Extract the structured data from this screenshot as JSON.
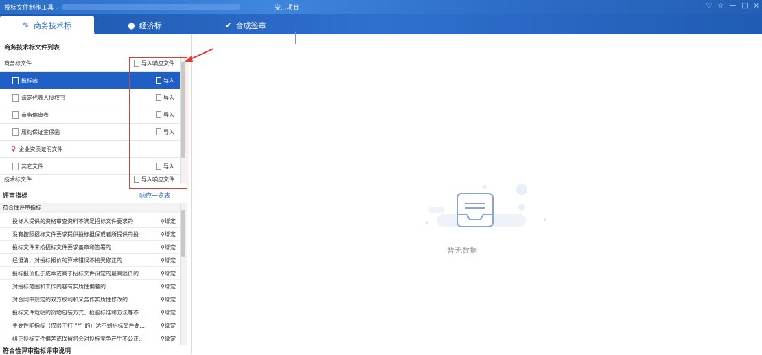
{
  "window": {
    "app_title": "投标文件制作工具 -",
    "project_suffix": "安...项目",
    "controls": [
      "♡",
      "☆",
      "—",
      "□",
      "×"
    ]
  },
  "tabs": [
    {
      "label": "商务技术标",
      "icon": "edit-icon"
    },
    {
      "label": "经济标",
      "icon": "yen-circle-icon"
    },
    {
      "label": "合成签章",
      "icon": "check-circle-icon"
    }
  ],
  "file_list": {
    "title": "商务技术标文件列表",
    "group_commercial": "商务标文件",
    "group_commercial_action": "导入响应文件",
    "items": [
      {
        "label": "投标函",
        "action": "导入",
        "selected": true
      },
      {
        "label": "法定代表人授权书",
        "action": "导入"
      },
      {
        "label": "商务偏离表",
        "action": "导入"
      },
      {
        "label": "履约保证金保函",
        "action": "导入"
      },
      {
        "label": "企业资质证明文件",
        "action": ""
      },
      {
        "label": "其它文件",
        "action": "导入"
      }
    ],
    "group_technical": "技术标文件",
    "group_technical_action": "导入响应文件"
  },
  "indicators": {
    "title": "评审指标",
    "link": "响应一览表",
    "group": "符合性评审指标",
    "bind_label": "绑定",
    "rows": [
      "投标人提供的资格审查资料不满足招标文件要求的",
      "没有按照招标文件要求提供投标担保或者所提供的投...",
      "投标文件未按招标文件要求盖章和签署的",
      "经澄清，对投标报价的算术错误不接受修正的",
      "投标报价低于成本或高于招标文件设定的最高限价的",
      "对投标范围和工作内容有实质性偏差的",
      "对合同中规定的双方权利和义务作实质性修改的",
      "投标文件载明的货物包装方式、检验标准和方法等不...",
      "主要性能指标（仅限于打 “*” 的）达不到招标文件要...",
      "纠正投标文件偏差或保留将会对投标竞争产生不公正..."
    ],
    "bottom_title": "符合性评审指标评审说明"
  },
  "empty_state": {
    "text": "暂无数据"
  }
}
